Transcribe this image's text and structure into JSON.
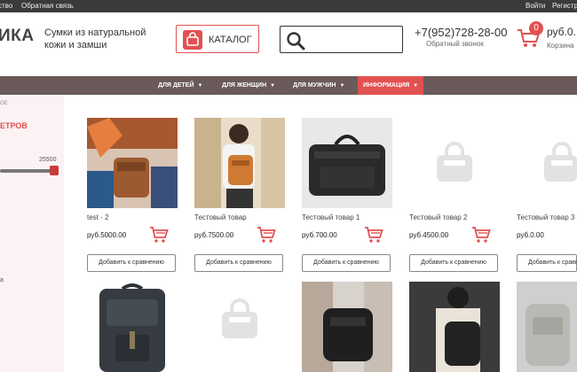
{
  "topbar": {
    "left_text": "ство",
    "feedback": "Обратная связь",
    "login": "Войти",
    "register": "Регистр"
  },
  "header": {
    "logo": "ИКА",
    "tagline": "Сумки из натуральной кожи и замши",
    "catalog_label": "КАТАЛОГ",
    "search_placeholder": "",
    "phone": "+7(952)728-28-00",
    "callback": "Обратный звонок",
    "cart_count": "0",
    "cart_sum": "руб.0.",
    "cart_label": "Корзина"
  },
  "nav": {
    "items": [
      {
        "label": "ДЛЯ ДЕТЕЙ"
      },
      {
        "label": "ДЛЯ ЖЕНЩИН"
      },
      {
        "label": "ДЛЯ МУЖЧИН"
      },
      {
        "label": "ИНФОРМАЦИЯ"
      }
    ]
  },
  "sidebar": {
    "crumb": "ОЕ",
    "filter_head": "ЕТРОВ",
    "price_max": "25500",
    "slider_fraction": 1.0,
    "side_a": "а"
  },
  "products": [
    {
      "name": "test - 2",
      "price": "руб.5000.00",
      "compare": "Добавить к сравнению",
      "image": "photo-woman-backpack"
    },
    {
      "name": "Тестовый товар",
      "price": "руб.7500.00",
      "compare": "Добавить к сравнению",
      "image": "photo-orange-backpack"
    },
    {
      "name": "Тестовый товар 1",
      "price": "руб.700.00",
      "compare": "Добавить к сравнению",
      "image": "photo-black-duffel"
    },
    {
      "name": "Тестовый товар 2",
      "price": "руб.4500.00",
      "compare": "Добавить к сравнению",
      "image": "placeholder-icon"
    },
    {
      "name": "Тестовый товар 3",
      "price": "руб.0.00",
      "compare": "Добавить к сравнению",
      "image": "placeholder-icon"
    }
  ],
  "colors": {
    "accent": "#e25151",
    "nav_bg": "#6b5a5a",
    "topbar_bg": "#3a3a3a",
    "sidebar_bg": "#fbf3f3"
  }
}
